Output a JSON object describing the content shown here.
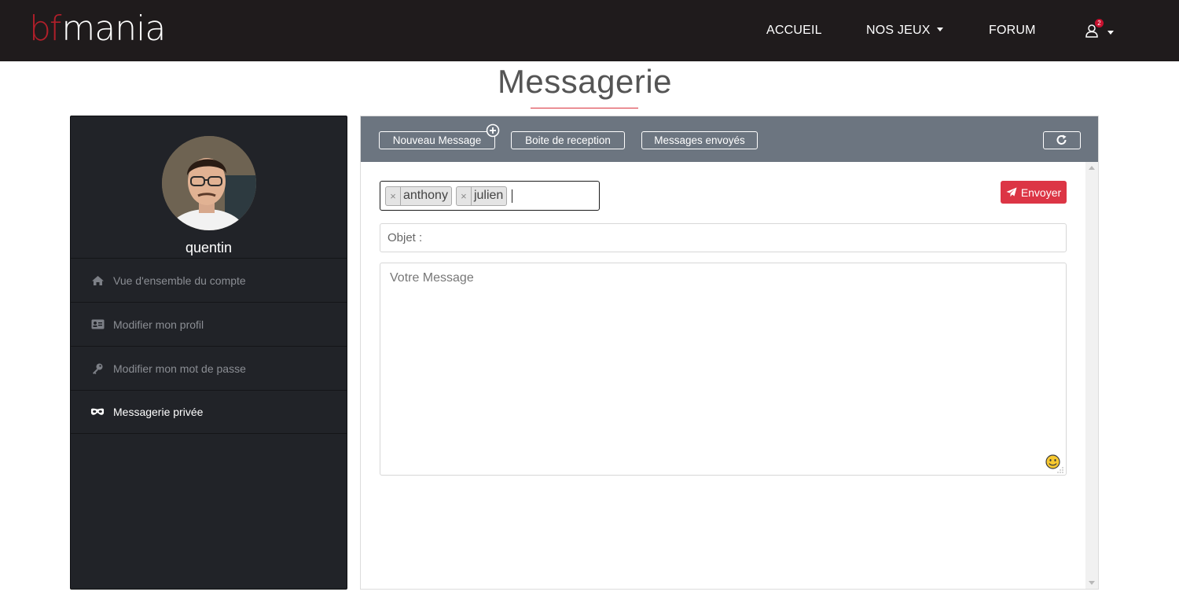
{
  "navbar": {
    "logo_prefix": "bf",
    "logo_suffix": "mania",
    "links": [
      {
        "label": "ACCUEIL"
      },
      {
        "label": "NOS JEUX"
      },
      {
        "label": "FORUM"
      }
    ],
    "notification_count": "2"
  },
  "page": {
    "title": "Messagerie"
  },
  "sidebar": {
    "username": "quentin",
    "items": [
      {
        "label": "Vue d'ensemble du compte",
        "icon": "home-icon"
      },
      {
        "label": "Modifier mon profil",
        "icon": "id-card-icon"
      },
      {
        "label": "Modifier mon mot de passe",
        "icon": "key-icon"
      },
      {
        "label": "Messagerie privée",
        "icon": "mask-icon",
        "active": true
      }
    ]
  },
  "toolbar": {
    "new_message": "Nouveau Message",
    "inbox": "Boite de reception",
    "sent": "Messages envoyés"
  },
  "compose": {
    "recipients": [
      "anthony",
      "julien"
    ],
    "send_label": "Envoyer",
    "subject_placeholder": "Objet :",
    "message_placeholder": "Votre Message"
  },
  "colors": {
    "navbar_bg": "#1f1b1c",
    "accent": "#dc3545",
    "sidebar_bg": "#212328",
    "toolbar_bg": "#6c7580"
  }
}
